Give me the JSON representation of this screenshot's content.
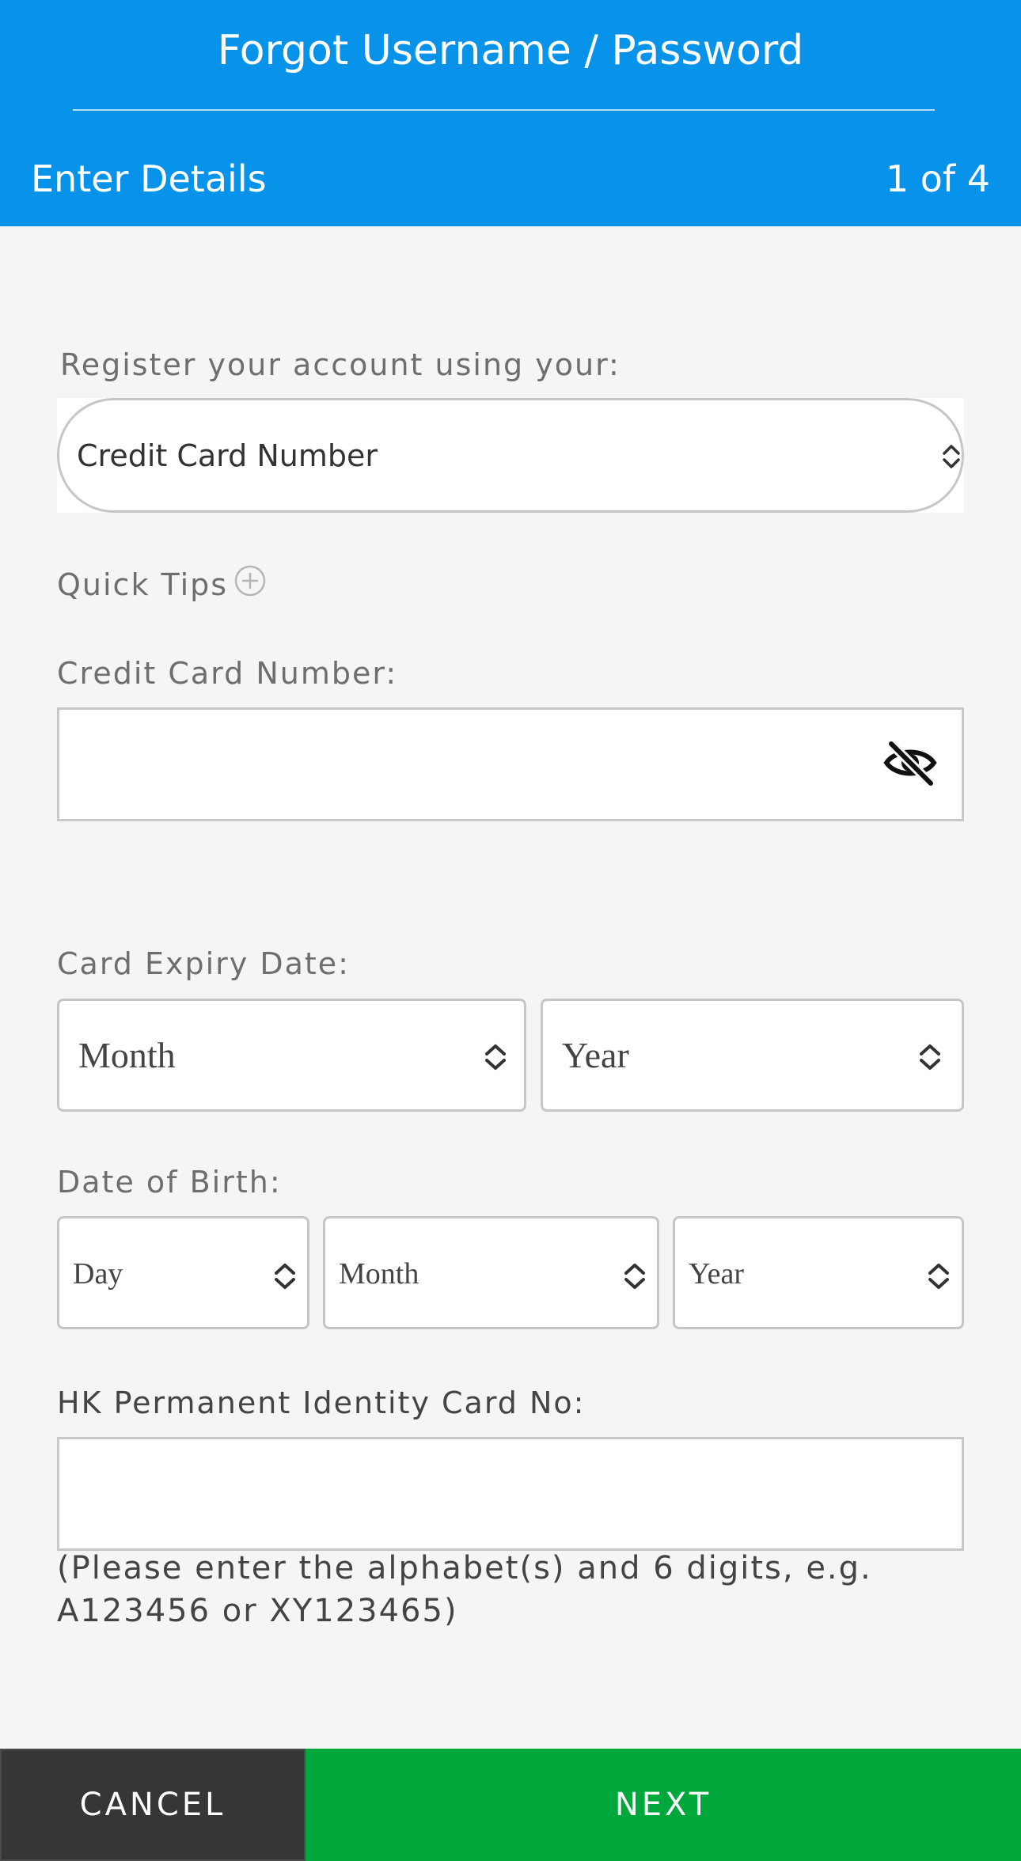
{
  "header": {
    "title": "Forgot Username / Password",
    "step_title": "Enter Details",
    "step_count": "1 of 4"
  },
  "register": {
    "label": "Register your account using your:",
    "selected": "Credit Card Number"
  },
  "quick_tips": {
    "label": "Quick Tips",
    "icon": "plus-circle-icon"
  },
  "card_number": {
    "label": "Credit Card Number:",
    "value": "",
    "toggle_icon": "eye-off-icon"
  },
  "expiry": {
    "label": "Card Expiry Date:",
    "month": "Month",
    "year": "Year"
  },
  "dob": {
    "label": "Date of Birth:",
    "day": "Day",
    "month": "Month",
    "year": "Year"
  },
  "hkid": {
    "label": "HK Permanent Identity Card No:",
    "value": "",
    "helper": "(Please enter the alphabet(s) and 6 digits, e.g. A123456 or XY123465)"
  },
  "footer": {
    "cancel": "CANCEL",
    "next": "NEXT"
  },
  "colors": {
    "header_bg": "#0893ea",
    "cancel_bg": "#353638",
    "next_bg": "#00a83b"
  }
}
